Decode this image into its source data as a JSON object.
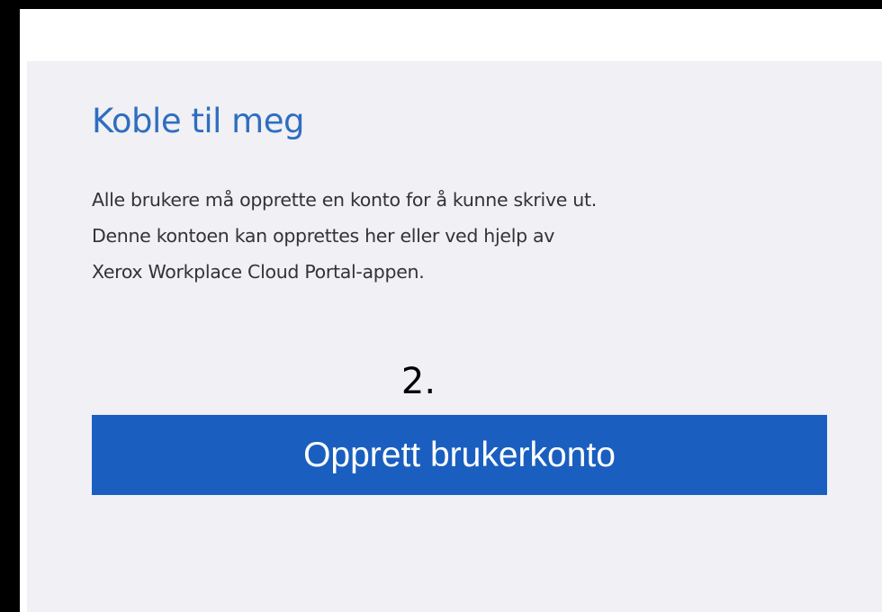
{
  "section": {
    "title": "Koble til meg",
    "description_lines": [
      "Alle brukere må opprette en konto for å kunne skrive ut.",
      "Denne kontoen kan opprettes her eller ved hjelp av",
      "Xerox Workplace Cloud Portal-appen."
    ],
    "step_marker": "2.",
    "create_account_button": "Opprett brukerkonto"
  },
  "colors": {
    "title": "#2f6ebf",
    "panel_background": "#f0f0f5",
    "button_background": "#1a5fbf",
    "button_text": "#ffffff",
    "frame_border": "#000000"
  }
}
